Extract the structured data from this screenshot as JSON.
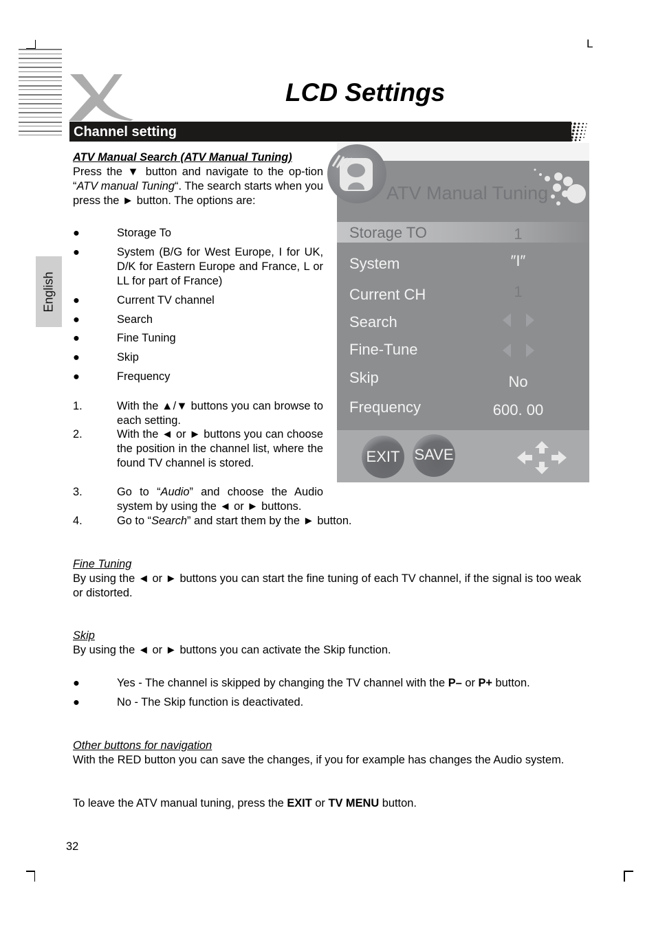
{
  "header": {
    "page_title": "LCD Settings",
    "corner_mark": "L",
    "logo": "x-brand-logo"
  },
  "section": {
    "title": "Channel setting"
  },
  "language_tab": "English",
  "atv_manual": {
    "heading": "ATV Manual Search (ATV Manual Tuning)",
    "intro_parts": {
      "p1": "Press the ▼ button and navigate to the op-tion “",
      "p1_italic": "ATV manual Tuning",
      "p2": "“. The search starts when you press the ► button. The options are:"
    },
    "options": [
      "Storage To",
      "System (B/G for West Europe, I for UK, D/K for Eastern Europe and France, L or LL for part of France)",
      "Current TV channel",
      "Search",
      "Fine Tuning",
      "Skip",
      "Frequency"
    ],
    "steps": [
      {
        "num": "1.",
        "text": "With the ▲/▼ buttons you can browse to each setting."
      },
      {
        "num": "2.",
        "text": "With the ◄ or ► buttons you can choose the position in the channel list, where the found TV channel is stored."
      },
      {
        "num": "3.",
        "pre": "Go to “",
        "italic": "Audio",
        "post": "” and choose the Audio system by using the ◄ or ► buttons."
      },
      {
        "num": "4.",
        "pre": "Go to “",
        "italic": "Search",
        "post": "” and start them by the ► button."
      }
    ]
  },
  "tv_menu": {
    "title": "ATV Manual Tuning",
    "rows": [
      {
        "label": "Storage TO",
        "value": "1",
        "type": "text",
        "highlighted": true
      },
      {
        "label": "System",
        "value": "″I″",
        "type": "text"
      },
      {
        "label": "Current CH",
        "value": "1",
        "type": "text",
        "dim": true
      },
      {
        "label": "Search",
        "value": "",
        "type": "arrows"
      },
      {
        "label": "Fine-Tune",
        "value": "",
        "type": "arrows"
      },
      {
        "label": "Skip",
        "value": "No",
        "type": "text"
      },
      {
        "label": "Frequency",
        "value": "600. 00",
        "type": "text"
      }
    ],
    "buttons": {
      "exit": "EXIT",
      "save": "SAVE"
    },
    "nav_icon": "four-way-arrows-icon"
  },
  "fine_tuning": {
    "heading": "Fine Tuning",
    "text": "By using the ◄ or ► buttons you can start the fine tuning of each TV channel, if the signal is too weak or distorted."
  },
  "skip": {
    "heading": "Skip",
    "text": "By using the ◄ or ► buttons you can activate the Skip function.",
    "bullets": [
      {
        "pre": "Yes - The channel is skipped by changing the TV channel with the ",
        "b1": "P–",
        "mid": " or ",
        "b2": "P+",
        "post": " button."
      },
      {
        "pre": "No - The Skip function is deactivated."
      }
    ]
  },
  "other_buttons": {
    "heading": "Other buttons for navigation",
    "text1": "With the RED button you can save the changes, if you for example has changes the Audio system.",
    "text2_pre": "To leave the ATV manual tuning, press the ",
    "text2_b1": "EXIT",
    "text2_mid": " or ",
    "text2_b2": "TV MENU",
    "text2_post": " button."
  },
  "footer": {
    "page_number": "32"
  },
  "bullet_glyph": "●"
}
